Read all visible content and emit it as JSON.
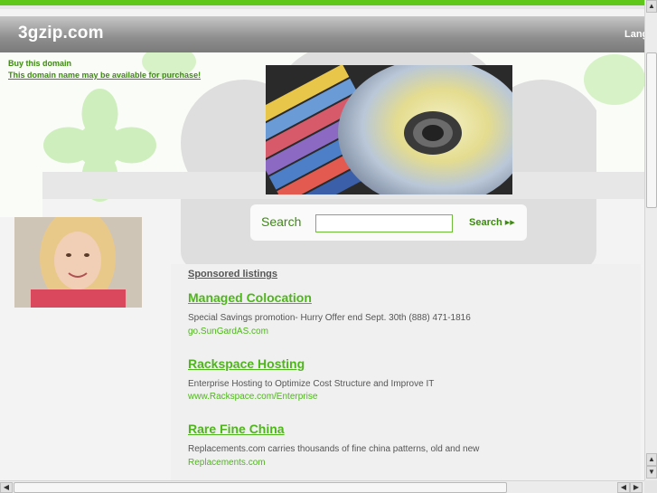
{
  "header": {
    "title": "3gzip.com",
    "lang_label": "Lang"
  },
  "domain_sale": {
    "buy_label": "Buy this domain",
    "available_label": "This domain name may be available for purchase!"
  },
  "search": {
    "label": "Search",
    "value": "",
    "button_label": "Search ▸▸"
  },
  "listings": {
    "heading": "Sponsored listings",
    "items": [
      {
        "title": "Managed Colocation",
        "desc": "Special Savings promotion- Hurry Offer end Sept. 30th (888) 471-1816",
        "url": "go.SunGardAS.com"
      },
      {
        "title": "Rackspace Hosting",
        "desc": "Enterprise Hosting to Optimize Cost Structure and Improve IT",
        "url": "www.Rackspace.com/Enterprise"
      },
      {
        "title": "Rare Fine China",
        "desc": "Replacements.com carries thousands of fine china patterns, old and new",
        "url": "Replacements.com"
      }
    ]
  },
  "colors": {
    "accent_green": "#4fb51c",
    "header_gray": "#8e8e8e"
  }
}
